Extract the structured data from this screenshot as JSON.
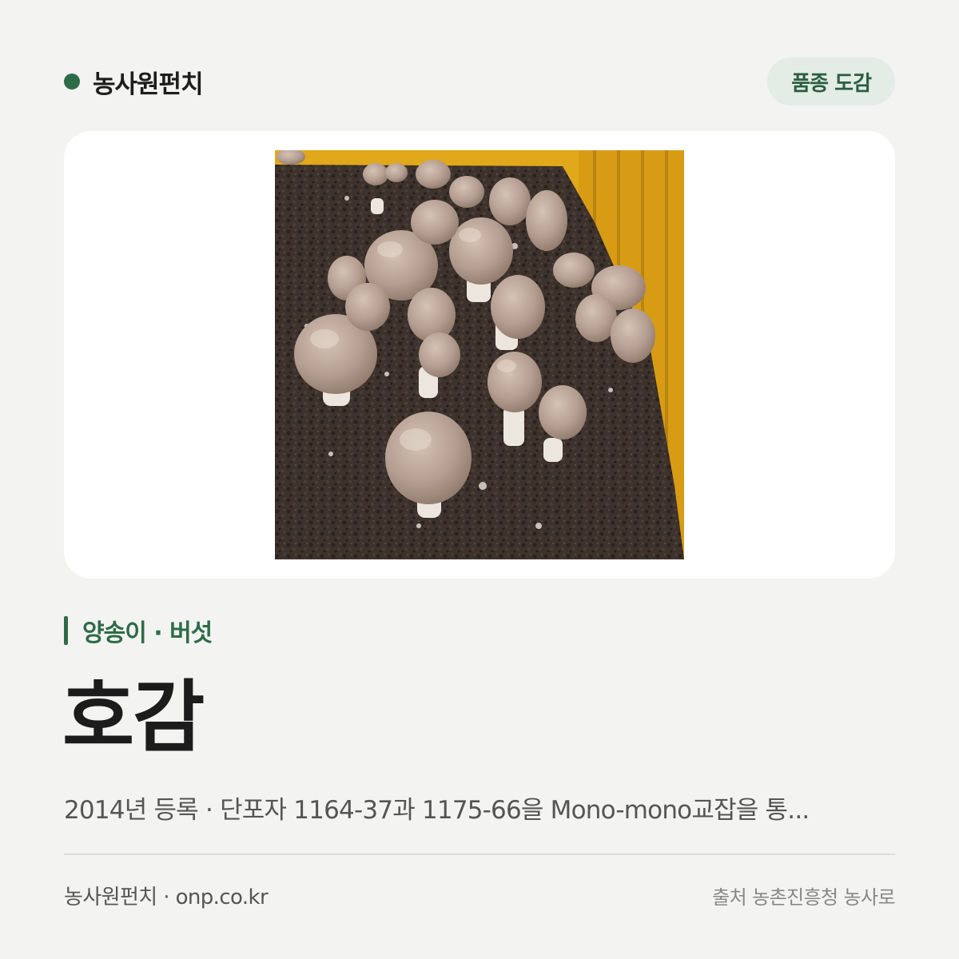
{
  "header": {
    "brand_name": "농사원펀치",
    "badge_label": "품종 도감"
  },
  "image": {
    "subject": "mushroom-photo"
  },
  "category": "양송이 · 버섯",
  "title": "호감",
  "description": "2014년 등록 · 단포자 1164-37과 1175-66을 Mono-mono교잡을 통...",
  "footer": {
    "left": "농사원펀치 · onp.co.kr",
    "right": "출처 농촌진흥청 농사로"
  },
  "colors": {
    "brand_green": "#2e6b48",
    "badge_bg": "#e3ece5",
    "page_bg": "#f3f3f1"
  }
}
